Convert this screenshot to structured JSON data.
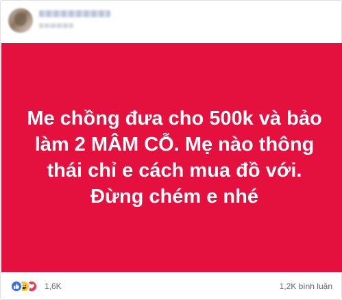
{
  "post": {
    "status_text": "Me chồng đưa cho 500k và bảo làm 2 MÂM CỖ. Mẹ nào thông thái chỉ e cách mua đồ với. Đừng chém e nhé",
    "background_color": "#e4113e",
    "text_color": "#ffffff"
  },
  "footer": {
    "reaction_icons": [
      "like-icon",
      "haha-icon",
      "love-icon"
    ],
    "reaction_count": "1,6K",
    "comment_count": "1,2K bình luận"
  }
}
